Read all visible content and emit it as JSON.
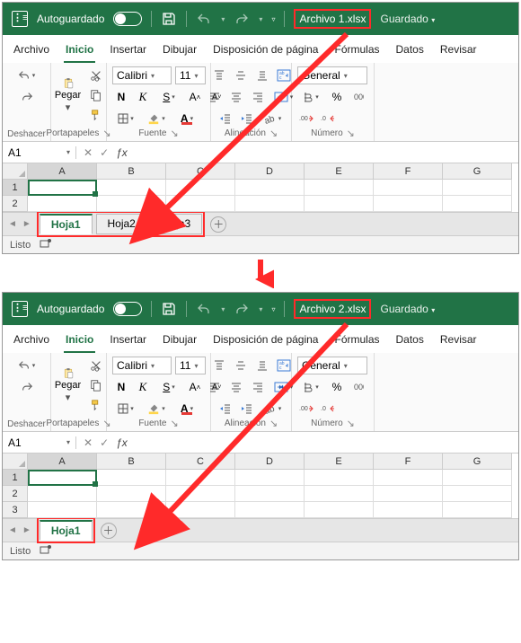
{
  "windows": [
    {
      "titlebar": {
        "autosave_label": "Autoguardado",
        "filename": "Archivo 1.xlsx",
        "saved": "Guardado"
      },
      "tabs": {
        "archivo": "Archivo",
        "inicio": "Inicio",
        "insertar": "Insertar",
        "dibujar": "Dibujar",
        "disposicion": "Disposición de página",
        "formulas": "Fórmulas",
        "datos": "Datos",
        "revisar": "Revisar"
      },
      "ribbon": {
        "undo": "Deshacer",
        "clipboard": "Portapapeles",
        "paste": "Pegar",
        "font_name": "Calibri",
        "font_size": "11",
        "font_group": "Fuente",
        "align_group": "Alineación",
        "number_group": "Número",
        "number_format": "General"
      },
      "namebox": "A1",
      "columns": [
        "A",
        "B",
        "C",
        "D",
        "E",
        "F",
        "G"
      ],
      "rows": [
        "1",
        "2"
      ],
      "sheet_tabs": [
        "Hoja1",
        "Hoja2",
        "Hoja3"
      ],
      "status": "Listo"
    },
    {
      "titlebar": {
        "autosave_label": "Autoguardado",
        "filename": "Archivo 2.xlsx",
        "saved": "Guardado"
      },
      "tabs": {
        "archivo": "Archivo",
        "inicio": "Inicio",
        "insertar": "Insertar",
        "dibujar": "Dibujar",
        "disposicion": "Disposición de página",
        "formulas": "Fórmulas",
        "datos": "Datos",
        "revisar": "Revisar"
      },
      "ribbon": {
        "undo": "Deshacer",
        "clipboard": "Portapapeles",
        "paste": "Pegar",
        "font_name": "Calibri",
        "font_size": "11",
        "font_group": "Fuente",
        "align_group": "Alineación",
        "number_group": "Número",
        "number_format": "General"
      },
      "namebox": "A1",
      "columns": [
        "A",
        "B",
        "C",
        "D",
        "E",
        "F",
        "G"
      ],
      "rows": [
        "1",
        "2",
        "3"
      ],
      "sheet_tabs": [
        "Hoja1"
      ],
      "status": "Listo"
    }
  ],
  "glyphs": {
    "dash": "—",
    "N": "N",
    "K": "K",
    "S": "S",
    "percent": "%"
  }
}
